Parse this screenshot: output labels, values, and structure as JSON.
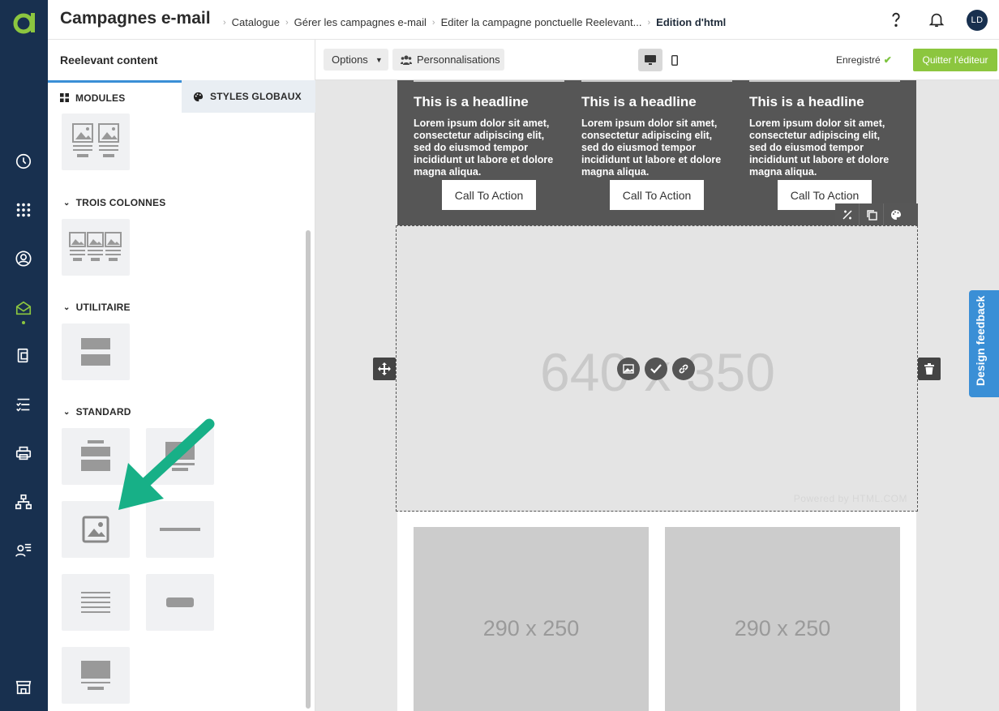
{
  "header": {
    "title": "Campagnes e-mail",
    "breadcrumbs": [
      "Catalogue",
      "Gérer les campagnes e-mail",
      "Editer la campagne ponctuelle Reelevant...",
      "Edition d'html"
    ],
    "avatar_initials": "LD",
    "help_icon": "question-icon",
    "notification_icon": "bell-icon"
  },
  "rail": {
    "logo": "reelevant-logo",
    "items": [
      {
        "icon": "dashboard-icon"
      },
      {
        "icon": "apps-grid-icon"
      },
      {
        "icon": "user-icon"
      },
      {
        "icon": "email-icon",
        "active": true
      },
      {
        "icon": "content-icon"
      },
      {
        "icon": "checklist-icon"
      },
      {
        "icon": "print-icon"
      },
      {
        "icon": "hierarchy-icon"
      },
      {
        "icon": "audience-icon"
      },
      {
        "icon": "store-icon"
      }
    ]
  },
  "panel": {
    "title": "Reelevant content",
    "tabs": [
      {
        "label": "MODULES",
        "active": true
      },
      {
        "label": "STYLES GLOBAUX",
        "active": false
      }
    ],
    "sections": [
      {
        "label": "TROIS COLONNES"
      },
      {
        "label": "UTILITAIRE"
      },
      {
        "label": "STANDARD"
      }
    ]
  },
  "toolbar": {
    "options_label": "Options",
    "personalize_label": "Personnalisations",
    "saved_label": "Enregistré",
    "quit_label": "Quitter l'éditeur"
  },
  "email": {
    "columns": [
      {
        "headline": "This is a headline",
        "body": "Lorem ipsum dolor sit amet, consectetur adipiscing elit, sed do eiusmod tempor incididunt ut labore et dolore magna aliqua.",
        "cta": "Call To Action"
      },
      {
        "headline": "This is a headline",
        "body": "Lorem ipsum dolor sit amet, consectetur adipiscing elit, sed do eiusmod tempor incididunt ut labore et dolore magna aliqua.",
        "cta": "Call To Action"
      },
      {
        "headline": "This is a headline",
        "body": "Lorem ipsum dolor sit amet, consectetur adipiscing elit, sed do eiusmod tempor incididunt ut labore et dolore magna aliqua.",
        "cta": "Call To Action"
      }
    ],
    "image_placeholder": "640 x 350",
    "powered_by": "Powered by HTML.COM",
    "small_placeholders": [
      "290 x 250",
      "290 x 250"
    ]
  },
  "feedback_label": "Design feedback",
  "colors": {
    "rail": "#18304f",
    "accent_green": "#8cc63f",
    "accent_blue": "#3a8fd6",
    "arrow": "#17b087"
  }
}
